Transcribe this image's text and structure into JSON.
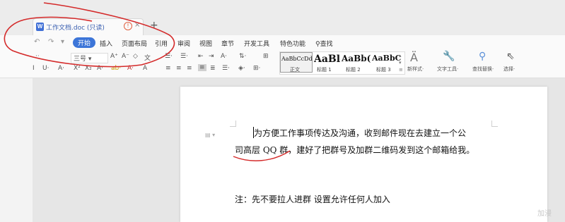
{
  "tab": {
    "icon_text": "W",
    "title": "工作文档.doc (只读)",
    "warn_symbol": "!",
    "close_symbol": "×",
    "new_tab_symbol": "+"
  },
  "quick_access": {
    "undo": "↶",
    "redo": "↷",
    "more": "▾"
  },
  "menu": [
    "开始",
    "插入",
    "页面布局",
    "引用",
    "审阅",
    "视图",
    "章节",
    "开发工具",
    "特色功能",
    "查找"
  ],
  "menu_active_index": 0,
  "ribbon": {
    "font_size": "三号",
    "row1_font_tools": [
      "A⁺",
      "A⁻",
      "◇",
      "文"
    ],
    "row2_font_tools": [
      "I",
      "U·",
      "A·",
      "X²",
      "X₂",
      "A·",
      "ab·",
      "A·",
      "A"
    ],
    "row1_para_tools": [
      "☰·",
      "☰·",
      "⇤",
      "⇥",
      "A·",
      "⇅·",
      "⊞"
    ],
    "row2_para_tools": [
      "≡",
      "≡",
      "≡",
      "≡",
      "≣",
      "☰·",
      "◈·",
      "⊞·"
    ],
    "styles": [
      {
        "sample": "AaBbCcDd",
        "label": "正文"
      },
      {
        "sample": "AaBl",
        "label": "标题 1"
      },
      {
        "sample": "AaBb(",
        "label": "标题 2"
      },
      {
        "sample": "AaBbC",
        "label": "标题 3"
      }
    ],
    "new_style": "新样式·",
    "text_tools": "文字工具·",
    "find_replace": "查找替换·",
    "select": "选择·"
  },
  "document": {
    "line1": "为方便工作事项传达及沟通，收到邮件现在去建立一个公",
    "line2": "司高层 QQ 群，建好了把群号及加群二维码发到这个邮箱给我。",
    "note": "注：先不要拉人进群    设置允许任何人加入"
  },
  "watermark": "加漫",
  "colors": {
    "accent": "#3c75d8",
    "annotation": "#d42a2a"
  }
}
